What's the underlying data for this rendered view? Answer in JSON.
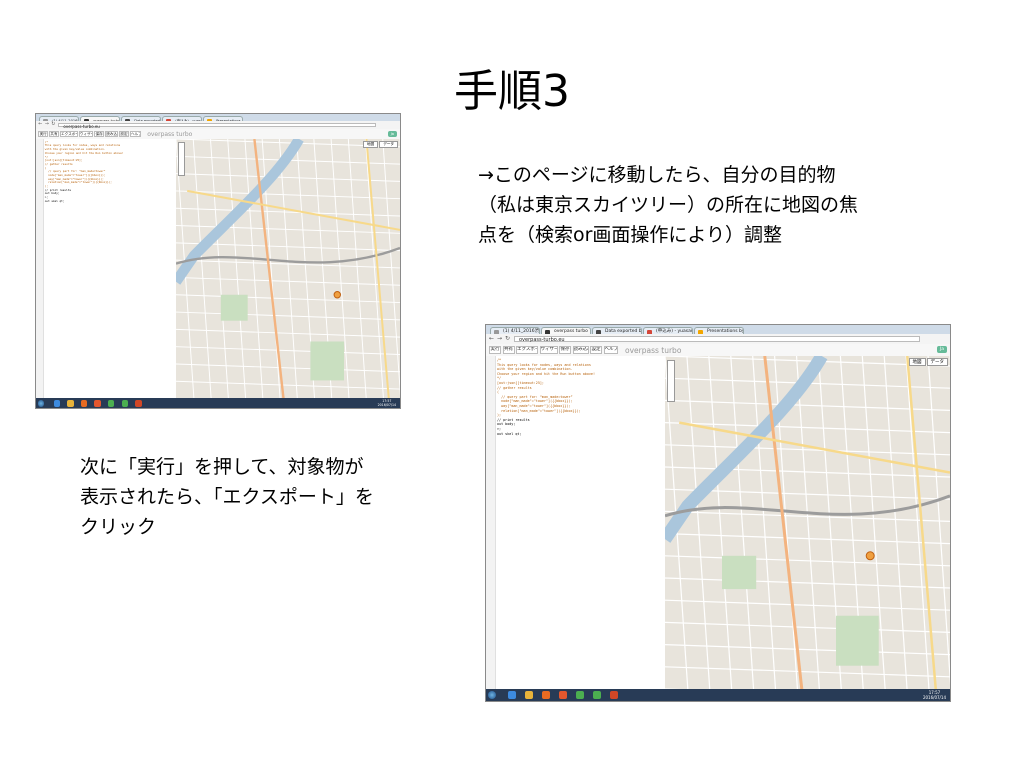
{
  "slide": {
    "title": "手順3",
    "note_right": [
      "→このページに移動したら、自分の目的物",
      "（私は東京スカイツリー）の所在に地図の焦",
      "点を（検索or画面操作により）調整"
    ],
    "note_left": [
      "次に「実行」を押して、対象物が",
      "表示されたら、「エクスポート」を",
      "クリック"
    ]
  },
  "browser": {
    "tabs": [
      {
        "label": "(1) 4/11_2016渋谷版…",
        "icon_color": "#999999"
      },
      {
        "label": "overpass turbo",
        "icon_color": "#333333"
      },
      {
        "label": "Data exported by over…",
        "icon_color": "#444444"
      },
      {
        "label": "(申込み) - yuasam…",
        "icon_color": "#d44638"
      },
      {
        "label": "Presentations by yuasa…",
        "icon_color": "#f2a600"
      }
    ],
    "url": "overpass-turbo.eu",
    "toolbar": {
      "buttons": [
        "実行",
        "共有",
        "エクスポート",
        "ウィザード",
        "保存",
        "読み込み",
        "設定",
        "ヘルプ"
      ],
      "brand": "overpass turbo",
      "lang": "Ja"
    },
    "map_tabs": [
      "地図",
      "データ"
    ],
    "code_lines": [
      "/*",
      "This query looks for nodes, ways and relations",
      "with the given key/value combination.",
      "Choose your region and hit the Run button above!",
      "*/",
      "[out:json][timeout:25];",
      "// gather results",
      "(",
      "  // query part for: “man_made=tower”",
      "  node[\"man_made\"=\"tower\"]({{bbox}});",
      "  way[\"man_made\"=\"tower\"]({{bbox}});",
      "  relation[\"man_made\"=\"tower\"]({{bbox}});",
      ");",
      "// print results",
      "out body;",
      ">;",
      "out skel qt;"
    ],
    "clock": {
      "time": "17:57",
      "date": "2016/07/14"
    }
  },
  "colors": {
    "taskbar": "#283b56",
    "river": "#aac6dc",
    "highway": "#f3b37f",
    "rail": "#9c9c9c",
    "code": "#b7610a"
  },
  "taskbar_icons": [
    {
      "name": "ie-icon",
      "color": "#3d8be0"
    },
    {
      "name": "folder-icon",
      "color": "#e8b33a"
    },
    {
      "name": "media-player-icon",
      "color": "#e86b22"
    },
    {
      "name": "firefox-icon",
      "color": "#e4572e"
    },
    {
      "name": "chrome-icon",
      "color": "#4caf50"
    },
    {
      "name": "chrome-icon",
      "color": "#4caf50"
    },
    {
      "name": "powerpoint-icon",
      "color": "#d24726"
    }
  ]
}
